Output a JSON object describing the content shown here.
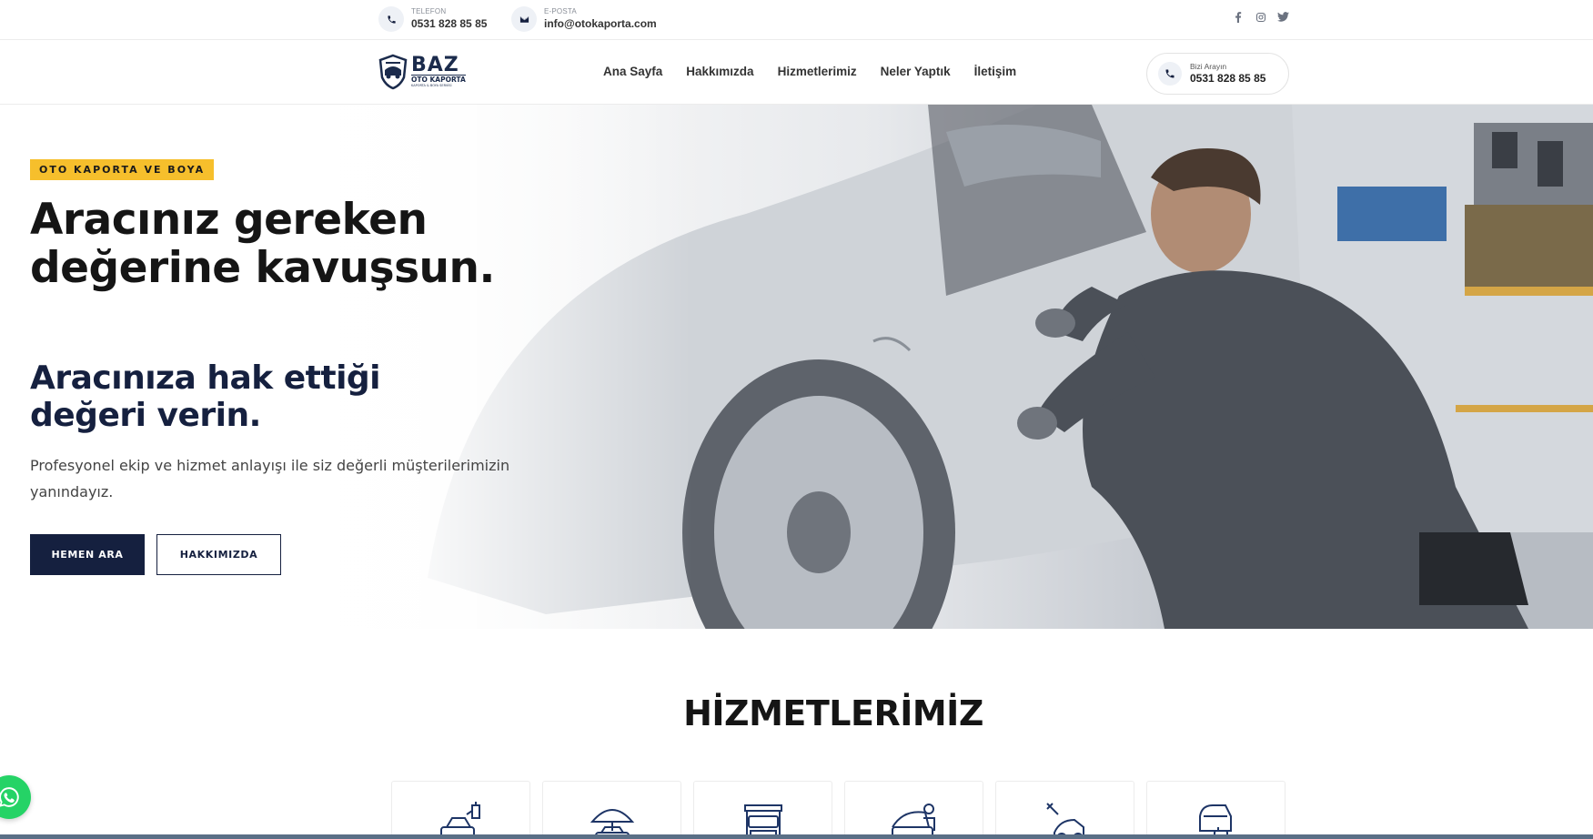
{
  "topbar": {
    "phone": {
      "label": "TELEFON",
      "value": "0531 828 85 85",
      "icon": "phone-icon"
    },
    "email": {
      "label": "E-POSTA",
      "value": "info@otokaporta.com",
      "icon": "mail-icon"
    },
    "socials": [
      "facebook-icon",
      "instagram-icon",
      "twitter-icon"
    ]
  },
  "header": {
    "logo": {
      "name": "BAZ",
      "sub": "OTO KAPORTA",
      "tagline": "KAPORTA & BOYA SERVİSİ"
    },
    "nav": [
      "Ana Sayfa",
      "Hakkımızda",
      "Hizmetlerimiz",
      "Neler Yaptık",
      "İletişim"
    ],
    "call": {
      "label": "Bizi Arayın",
      "value": "0531 828 85 85"
    }
  },
  "hero": {
    "badge": "OTO KAPORTA VE BOYA",
    "title": "Aracınız gereken değerine kavuşsun.",
    "subtitle": "Aracınıza hak ettiği değeri verin.",
    "lead": "Profesyonel ekip ve hizmet anlayışı ile siz değerli müşterilerimizin yanındayız.",
    "buttons": {
      "primary": "HEMEN ARA",
      "secondary": "HAKKIMIZDA"
    }
  },
  "services": {
    "title": "HİZMETLERİMİZ",
    "icons": [
      "paint-spray-icon",
      "car-insurance-icon",
      "car-lift-icon",
      "mechanic-icon",
      "dent-repair-icon",
      "car-wash-icon"
    ]
  },
  "colors": {
    "navy": "#15203f",
    "accent": "#f6bf2c",
    "whatsapp": "#25d366"
  }
}
